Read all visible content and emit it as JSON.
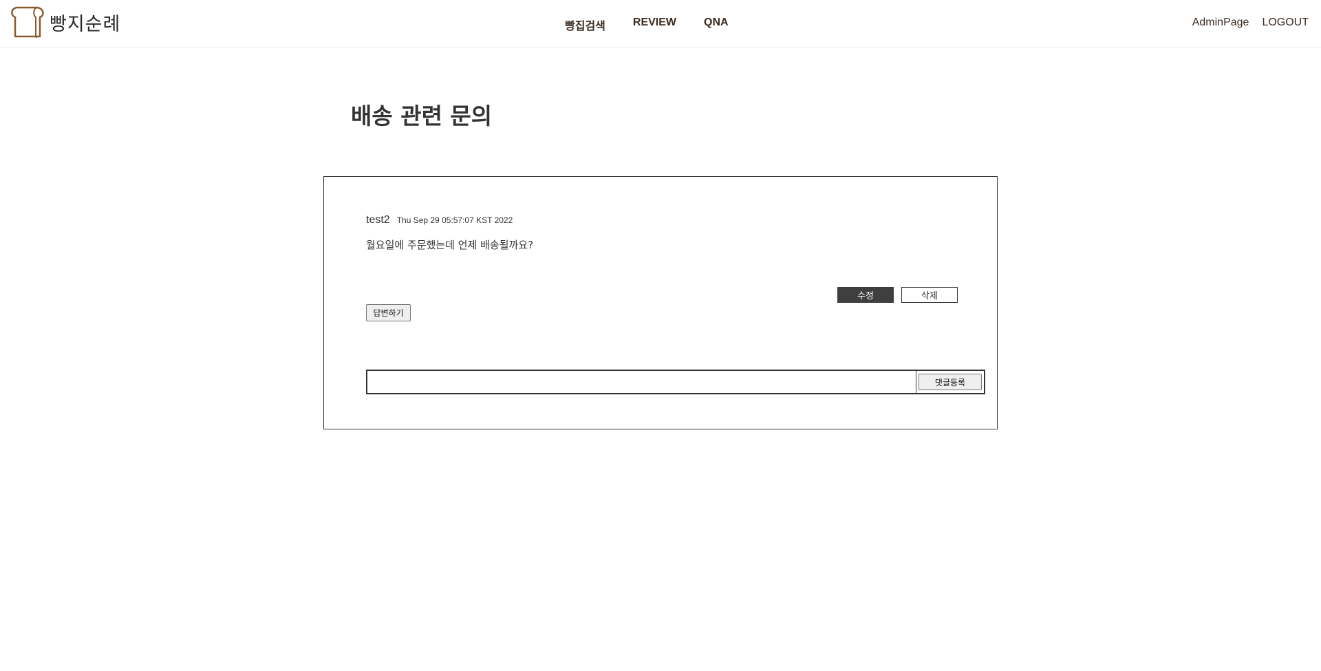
{
  "header": {
    "logo_text": "빵지순례",
    "nav": {
      "search": "빵집검색",
      "review": "REVIEW",
      "qna": "QNA"
    },
    "admin_link": "AdminPage",
    "logout_link": "LOGOUT"
  },
  "post": {
    "title": "배송 관련 문의",
    "author": "test2",
    "date": "Thu Sep 29 05:57:07 KST 2022",
    "content": "월요일에 주문했는데 언제 배송될까요?",
    "edit_label": "수정",
    "delete_label": "삭제",
    "reply_label": "답변하기"
  },
  "comment": {
    "input_value": "",
    "submit_label": "댓글등록"
  },
  "colors": {
    "logo_brown": "#8B5A2B",
    "dark_button": "#3f3f3f",
    "text": "#333333"
  }
}
